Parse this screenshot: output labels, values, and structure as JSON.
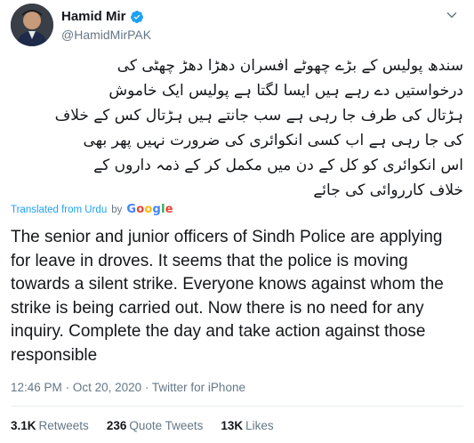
{
  "author": {
    "name": "Hamid Mir",
    "handle": "@HamidMirPAK",
    "verified": true
  },
  "tweet": {
    "urdu_lines": [
      "سندھ پولیس کے بڑے چھوٹے افسران دھڑا دھڑ چھٹی کی",
      "درخواستیں دے رہے ہیں ایسا لگتا ہے پولیس ایک خاموش",
      "ہڑتال کی طرف جا رہی ہے سب جانتے ہیں ہڑتال کس کے خلاف",
      "کی جا رہی ہے اب کسی انکوائری کی ضرورت نہیں پھر بھی",
      "اس انکوائری کو کل کے دن میں مکمل کر کے ذمہ داروں کے",
      "خلاف کارروائی کی جائے"
    ],
    "translated_label": "Translated from Urdu",
    "translated_by": "by",
    "translator": "Google",
    "english": "The senior and junior officers of Sindh Police are applying for leave in droves. It seems that the police is moving towards a silent strike. Everyone knows against whom the strike is being carried out. Now there is no need for any inquiry. Complete the day and take action against those responsible"
  },
  "meta": {
    "time": "12:46 PM",
    "date": "Oct 20, 2020",
    "source": "Twitter for iPhone",
    "separator": "·"
  },
  "stats": [
    {
      "count": "3.1K",
      "label": "Retweets"
    },
    {
      "count": "236",
      "label": "Quote Tweets"
    },
    {
      "count": "13K",
      "label": "Likes"
    }
  ],
  "colors": {
    "link_blue": "#1da1f2",
    "muted": "#657786",
    "text": "#14171a",
    "divider": "#e6ecf0"
  },
  "icons": {
    "verified": "verified-badge-icon",
    "more": "chevron-down-icon"
  }
}
